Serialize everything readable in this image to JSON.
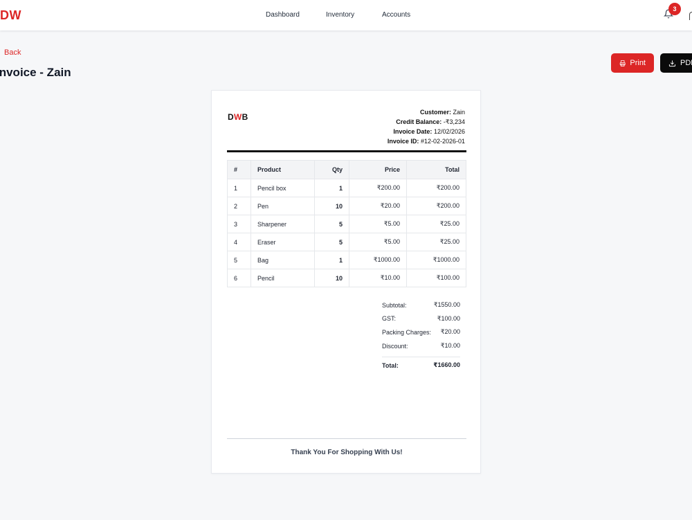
{
  "header": {
    "logo": "DW",
    "nav": [
      "Dashboard",
      "Inventory",
      "Accounts"
    ],
    "notification_count": "3",
    "icons": {
      "bell": "bell-icon",
      "user": "user-icon"
    },
    "brand_color": "#dc2626"
  },
  "page": {
    "back_label": "Back",
    "title": "Invoice - Zain",
    "print_label": "Print",
    "pdf_label": "PDF"
  },
  "invoice": {
    "brand_prefix": "D",
    "brand_accent": "W",
    "brand_suffix": "B",
    "customer_label": "Customer:",
    "customer": "Zain",
    "credit_label": "Credit Balance:",
    "credit_balance": "-₹3,234",
    "date_label": "Invoice Date:",
    "invoice_date": "12/02/2026",
    "id_label": "Invoice ID:",
    "invoice_id": "#12-02-2026-01",
    "columns": [
      "#",
      "Product",
      "Qty",
      "Price",
      "Total"
    ],
    "items": [
      {
        "n": "1",
        "product": "Pencil box",
        "qty": "1",
        "price": "₹200.00",
        "total": "₹200.00"
      },
      {
        "n": "2",
        "product": "Pen",
        "qty": "10",
        "price": "₹20.00",
        "total": "₹200.00"
      },
      {
        "n": "3",
        "product": "Sharpener",
        "qty": "5",
        "price": "₹5.00",
        "total": "₹25.00"
      },
      {
        "n": "4",
        "product": "Eraser",
        "qty": "5",
        "price": "₹5.00",
        "total": "₹25.00"
      },
      {
        "n": "5",
        "product": "Bag",
        "qty": "1",
        "price": "₹1000.00",
        "total": "₹1000.00"
      },
      {
        "n": "6",
        "product": "Pencil",
        "qty": "10",
        "price": "₹10.00",
        "total": "₹100.00"
      }
    ],
    "summary": [
      {
        "label": "Subtotal:",
        "value": "₹1550.00"
      },
      {
        "label": "GST:",
        "value": "₹100.00"
      },
      {
        "label": "Packing Charges:",
        "value": "₹20.00"
      },
      {
        "label": "Discount:",
        "value": "₹10.00"
      }
    ],
    "grand_label": "Total:",
    "grand_value": "₹1660.00",
    "footer": "Thank You For Shopping With Us!"
  }
}
